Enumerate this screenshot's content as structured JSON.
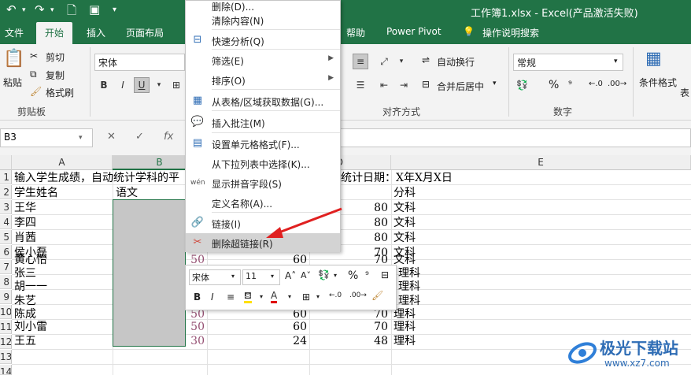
{
  "titlebar": {
    "title": "工作簿1.xlsx - Excel(产品激活失败)"
  },
  "tabs": [
    "文件",
    "开始",
    "插入",
    "页面布局",
    "帮助",
    "Power Pivot",
    "操作说明搜索"
  ],
  "ribbon": {
    "clipboard": {
      "paste": "粘贴",
      "cut": "剪切",
      "copy": "复制",
      "format_painter": "格式刷",
      "label": "剪贴板"
    },
    "font": {
      "name": "宋体"
    },
    "alignment": {
      "wrap": "自动换行",
      "merge": "合并后居中",
      "label": "对齐方式"
    },
    "number": {
      "format": "常规",
      "percent": "%",
      "label": "数字"
    },
    "styles": {
      "conditional": "条件格式",
      "more": "表"
    }
  },
  "formula_bar": {
    "name_box": "B3",
    "fx": "fx"
  },
  "sheet": {
    "columns": [
      "A",
      "B",
      "C",
      "D",
      "E"
    ],
    "rows": [
      "1",
      "2",
      "3",
      "4",
      "5",
      "6",
      "7",
      "8",
      "9",
      "10",
      "11",
      "12",
      "13",
      "14"
    ],
    "row1_a": "输入学生成绩，自动统计学科的平",
    "row1_d": "统计日期：X年X月X日",
    "row2_a": "学生姓名",
    "row2_b": "语文",
    "row2_e": "分科",
    "students": [
      {
        "name": "王华",
        "d": "80",
        "e": "文科"
      },
      {
        "name": "李四",
        "d": "80",
        "e": "文科"
      },
      {
        "name": "肖茜",
        "d": "80",
        "e": "文科"
      },
      {
        "name": "侯小磊",
        "d": "70",
        "e": "文科"
      },
      {
        "name": "黄心怡",
        "b": "50",
        "c": "60",
        "d": "70",
        "e": "文科"
      },
      {
        "name": "张三",
        "e": "理科"
      },
      {
        "name": "胡一一",
        "e": "理科"
      },
      {
        "name": "朱艺",
        "e": "理科"
      },
      {
        "name": "陈成",
        "b": "50",
        "c": "60",
        "d": "70",
        "e": "理科"
      },
      {
        "name": "刘小雷",
        "b": "50",
        "c": "60",
        "d": "70",
        "e": "理科"
      },
      {
        "name": "王五",
        "b": "30",
        "c": "24",
        "d": "48",
        "e": "理科"
      }
    ]
  },
  "context_menu": {
    "items": [
      {
        "label": "删除(D)...",
        "icon": "none"
      },
      {
        "label": "清除内容(N)",
        "icon": "none"
      },
      {
        "label": "快速分析(Q)",
        "icon": "quick-analysis"
      },
      {
        "label": "筛选(E)",
        "icon": "none",
        "submenu": true
      },
      {
        "label": "排序(O)",
        "icon": "none",
        "submenu": true
      },
      {
        "label": "从表格/区域获取数据(G)...",
        "icon": "table"
      },
      {
        "label": "插入批注(M)",
        "icon": "comment"
      },
      {
        "label": "设置单元格格式(F)...",
        "icon": "format-cells"
      },
      {
        "label": "从下拉列表中选择(K)...",
        "icon": "none"
      },
      {
        "label": "显示拼音字段(S)",
        "icon": "phonetic"
      },
      {
        "label": "定义名称(A)...",
        "icon": "none"
      },
      {
        "label": "链接(I)",
        "icon": "link"
      },
      {
        "label": "删除超链接(R)",
        "icon": "remove-link",
        "highlighted": true
      }
    ]
  },
  "mini_toolbar": {
    "font": "宋体",
    "size": "11",
    "bold": "B",
    "italic": "I",
    "percent": "%"
  },
  "watermark": {
    "text": "极光下载站",
    "url": "www.xz7.com"
  }
}
